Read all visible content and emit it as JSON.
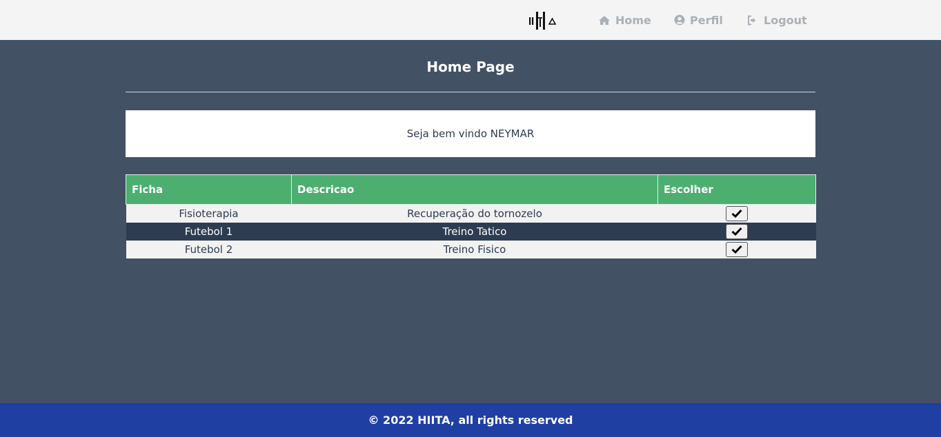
{
  "nav": {
    "home_label": "Home",
    "perfil_label": "Perfil",
    "logout_label": "Logout",
    "text_color": "#aab0b6"
  },
  "page": {
    "title": "Home Page",
    "welcome": "Seja bem vindo NEYMAR"
  },
  "table": {
    "headers": [
      "Ficha",
      "Descricao",
      "Escolher"
    ],
    "header_color": "#4caf70",
    "rows": [
      {
        "ficha": "Fisioterapia",
        "descricao": "Recuperação do tornozelo"
      },
      {
        "ficha": "Futebol 1",
        "descricao": "Treino Tatico"
      },
      {
        "ficha": "Futebol 2",
        "descricao": "Treino Fisico"
      }
    ]
  },
  "footer": {
    "text": "© 2022 HIITA, all rights reserved",
    "color": "#1f3fa3"
  },
  "icons": {
    "logo": "hiita-logo",
    "home": "home-icon",
    "perfil": "user-circle-icon",
    "logout": "sign-out-icon",
    "escolher": "check-icon"
  }
}
